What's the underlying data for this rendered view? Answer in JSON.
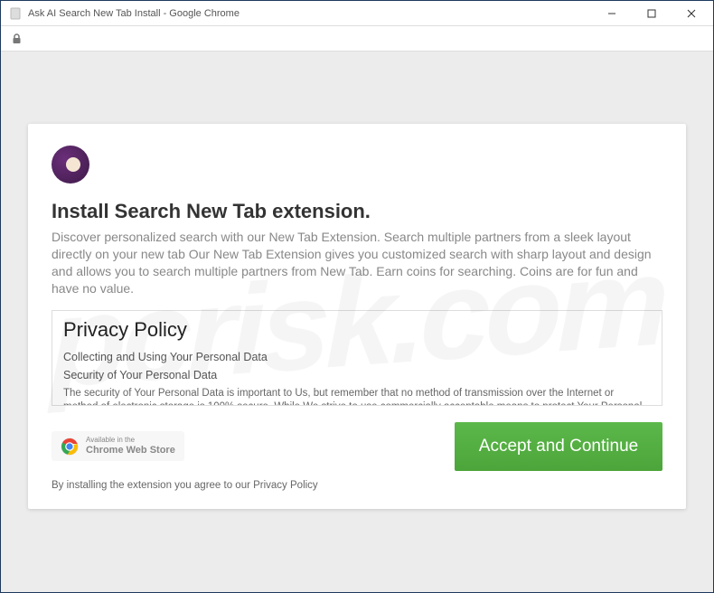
{
  "window": {
    "title": "Ask AI Search New Tab Install - Google Chrome"
  },
  "card": {
    "heading": "Install Search New Tab extension.",
    "description": "Discover personalized search with our New Tab Extension. Search multiple partners from a sleek layout directly on your new tab Our New Tab Extension gives you customized search with sharp layout and design and allows you to search multiple partners from New Tab. Earn coins for searching. Coins are for fun and have no value."
  },
  "policy": {
    "title": "Privacy Policy",
    "section1": "Collecting and Using Your Personal Data",
    "section2": "Security of Your Personal Data",
    "body": "The security of Your Personal Data is important to Us, but remember that no method of transmission over the Internet or method of electronic storage is 100% secure. While We strive to use commercially acceptable means to protect Your Personal Data, We cannot guarantee its absolute security."
  },
  "badge": {
    "top": "Available in the",
    "bottom": "Chrome Web Store"
  },
  "button": {
    "accept": "Accept and Continue"
  },
  "footer": {
    "agree": "By installing the extension you agree to our Privacy Policy"
  },
  "watermark": "pcrisk.com"
}
